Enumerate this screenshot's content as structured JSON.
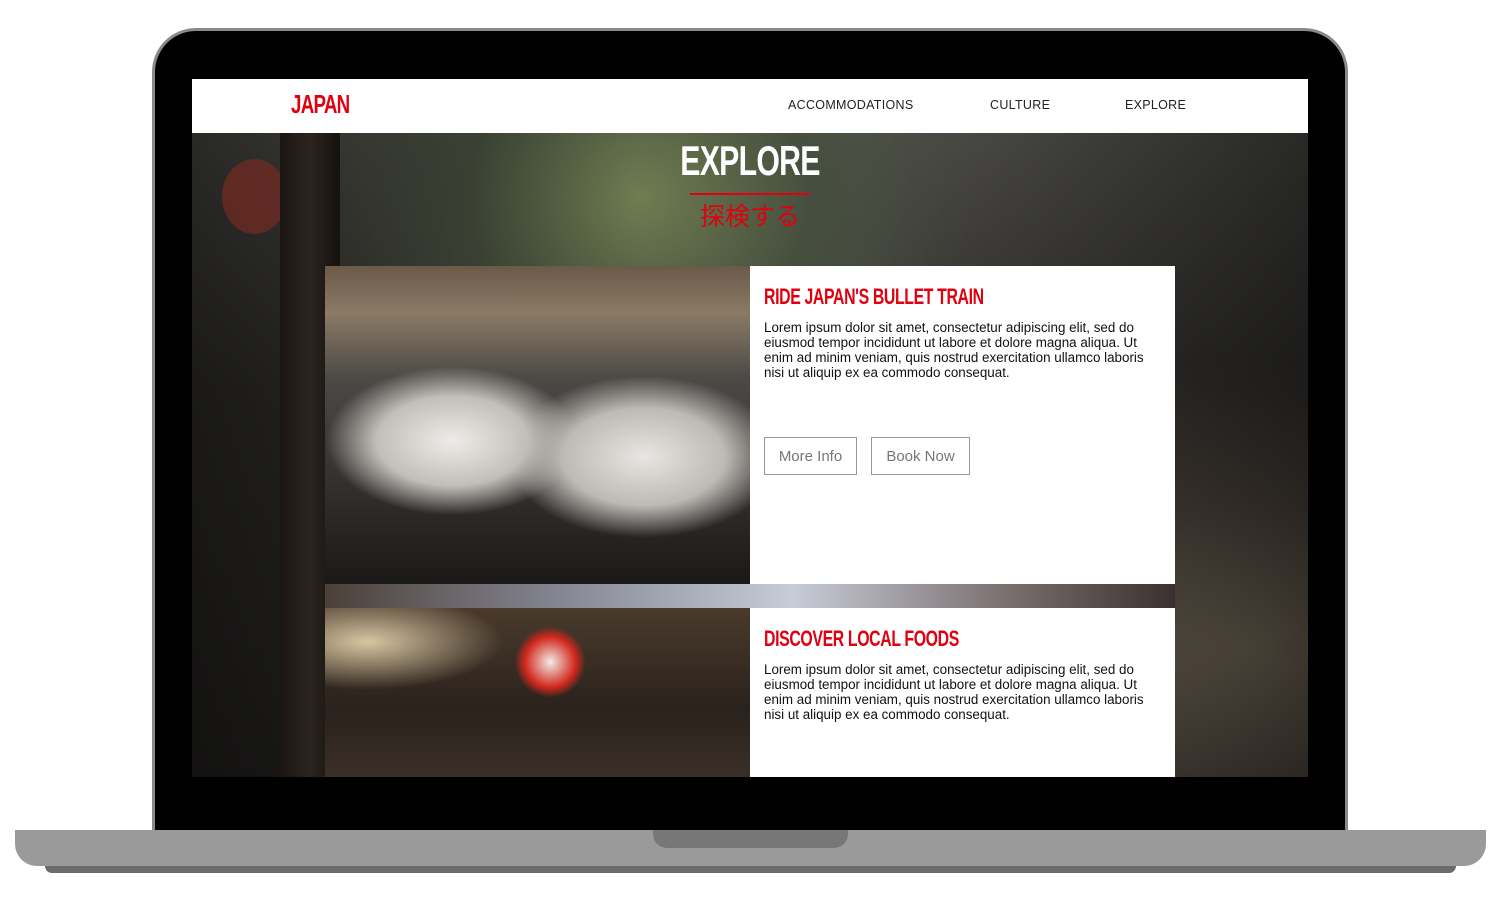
{
  "nav": {
    "logo": "JAPAN",
    "links": [
      "ACCOMMODATIONS",
      "CULTURE",
      "EXPLORE"
    ]
  },
  "hero": {
    "title": "EXPLORE",
    "subtitle": "探検する"
  },
  "cards": [
    {
      "title": "RIDE JAPAN'S BULLET TRAIN",
      "text": "Lorem ipsum dolor sit amet, consectetur adipiscing elit, sed do eiusmod tempor incididunt ut labore et dolore magna aliqua. Ut enim ad minim veniam, quis nostrud exercitation ullamco laboris nisi ut aliquip ex ea commodo consequat.",
      "more": "More Info",
      "book": "Book Now"
    },
    {
      "title": "DISCOVER LOCAL FOODS",
      "text": "Lorem ipsum dolor sit amet, consectetur adipiscing elit, sed do eiusmod tempor incididunt ut labore et dolore magna aliqua. Ut enim ad minim veniam, quis nostrud exercitation ullamco laboris nisi ut aliquip ex ea commodo consequat."
    }
  ],
  "colors": {
    "accent": "#e0000f"
  }
}
